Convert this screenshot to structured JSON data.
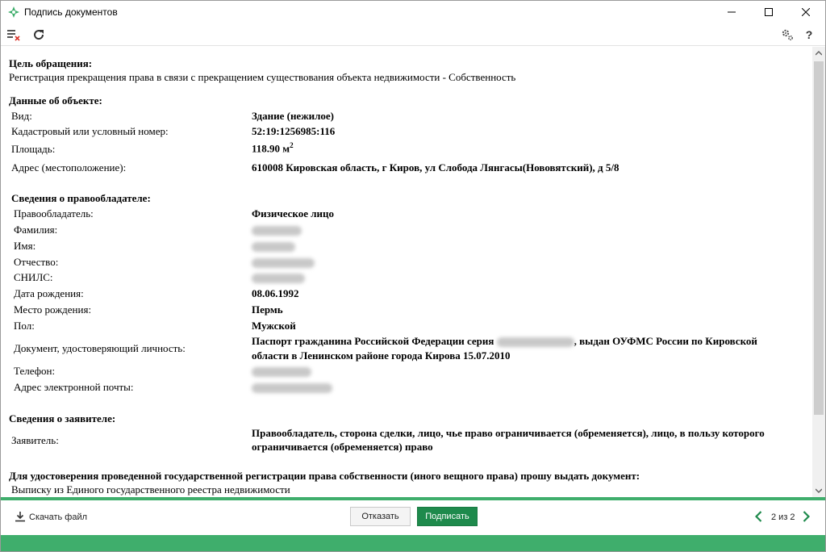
{
  "window": {
    "title": "Подпись документов",
    "accent_color": "#1e8a4c",
    "status_color": "#3fae6c"
  },
  "toolbar": {
    "clear_icon": "list-clear-icon",
    "refresh_icon": "refresh-icon",
    "settings_icon": "gears-icon",
    "help_label": "?"
  },
  "content": {
    "purpose": {
      "heading": "Цель обращения:",
      "text": "Регистрация прекращения права в связи с прекращением существования объекта недвижимости - Собственность"
    },
    "object": {
      "heading": "Данные об объекте:",
      "rows": [
        {
          "label": "Вид:",
          "value": "Здание (нежилое)"
        },
        {
          "label": "Кадастровый или условный номер:",
          "value": "52:19:1256985:116"
        },
        {
          "label": "Площадь:",
          "value": "118.90 м",
          "unit_sup": "2"
        },
        {
          "label": "Адрес (местоположение):",
          "value": "610008 Кировская область, г Киров, ул Слобода Лянгасы(Нововятский), д 5/8"
        }
      ]
    },
    "holder": {
      "heading": "Сведения о правообладателе:",
      "rows": [
        {
          "label": "Правообладатель:",
          "value": "Физическое лицо"
        },
        {
          "label": "Фамилия:",
          "value": ""
        },
        {
          "label": "Имя:",
          "value": ""
        },
        {
          "label": "Отчество:",
          "value": ""
        },
        {
          "label": "СНИЛС:",
          "value": ""
        },
        {
          "label": "Дата рождения:",
          "value": "08.06.1992"
        },
        {
          "label": "Место рождения:",
          "value": "Пермь"
        },
        {
          "label": "Пол:",
          "value": "Мужской"
        },
        {
          "label": "Документ, удостоверяющий личность:",
          "value_part1": "Паспорт гражданина Российской Федерации серия",
          "value_part2": ", выдан ОУФМС России по Кировской",
          "value_line2": "области в Ленинском районе города Кирова 15.07.2010"
        },
        {
          "label": "Телефон:",
          "value": ""
        },
        {
          "label": "Адрес электронной почты:",
          "value": ""
        }
      ]
    },
    "applicant": {
      "heading": "Сведения о заявителе:",
      "label": "Заявитель:",
      "value_line1": "Правообладатель, сторона сделки, лицо, чье право ограничивается (обременяется), лицо, в пользу которого",
      "value_line2": "ограничивается (обременяется) право"
    },
    "document_request": {
      "heading": "Для удостоверения проведенной государственной регистрации права собственности (иного вещного права) прошу выдать документ:",
      "text": "Выписку из Единого государственного реестра недвижимости"
    }
  },
  "footer": {
    "download_label": "Скачать файл",
    "refuse_label": "Отказать",
    "sign_label": "Подписать",
    "pager": "2 из 2"
  }
}
